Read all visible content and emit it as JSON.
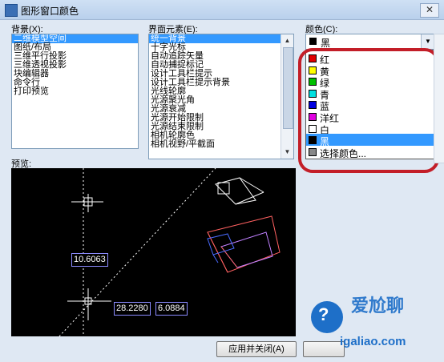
{
  "window": {
    "title": "图形窗口颜色",
    "close_label": "✕"
  },
  "context": {
    "label": "背景(X):",
    "items": [
      "二维模型空间",
      "图纸/布局",
      "三维平行投影",
      "三维透视投影",
      "块编辑器",
      "命令行",
      "打印预览"
    ],
    "selected_index": 0
  },
  "interface_elements": {
    "label": "界面元素(E):",
    "items": [
      "统一背景",
      "十字光标",
      "自动追踪矢量",
      "自动捕捉标记",
      "设计工具栏提示",
      "设计工具栏提示背景",
      "光线轮廓",
      "光源聚光角",
      "光源衰减",
      "光源开始限制",
      "光源结束限制",
      "相机轮廓色",
      "相机视野/平截面"
    ],
    "selected_index": 0
  },
  "color": {
    "label": "颜色(C):",
    "current": {
      "name": "黑",
      "swatch": "#000000"
    },
    "options": [
      {
        "name": "红",
        "swatch": "#e00000"
      },
      {
        "name": "黄",
        "swatch": "#ffff00"
      },
      {
        "name": "绿",
        "swatch": "#00c000"
      },
      {
        "name": "青",
        "swatch": "#00e0e0"
      },
      {
        "name": "蓝",
        "swatch": "#0000e0"
      },
      {
        "name": "洋红",
        "swatch": "#e000e0"
      },
      {
        "name": "白",
        "swatch": "#ffffff"
      },
      {
        "name": "黑",
        "swatch": "#000000"
      },
      {
        "name": "选择颜色...",
        "swatch": "#888888"
      }
    ],
    "selected_index": 7
  },
  "preview": {
    "label": "预览:",
    "dims": [
      "10.6063",
      "28.2280",
      "6.0884"
    ]
  },
  "buttons": {
    "apply_close": "应用并关闭(A)"
  },
  "watermark": {
    "text": "爱尬聊",
    "url": "igaliao.com"
  }
}
